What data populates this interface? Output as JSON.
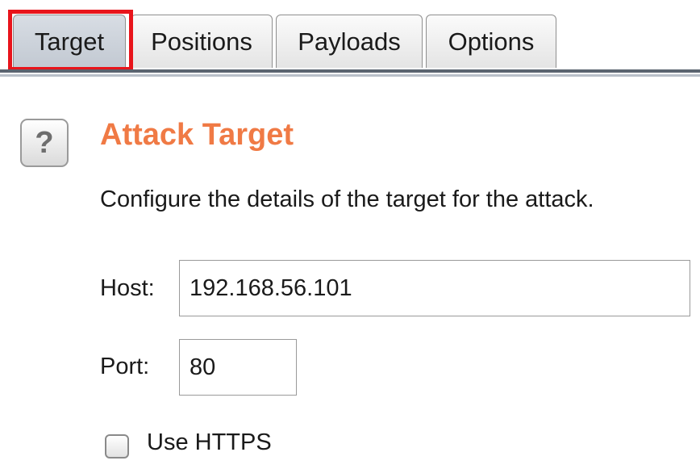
{
  "tabs": [
    {
      "label": "Target",
      "active": true
    },
    {
      "label": "Positions",
      "active": false
    },
    {
      "label": "Payloads",
      "active": false
    },
    {
      "label": "Options",
      "active": false
    }
  ],
  "highlight_color": "#e8141b",
  "help_button": {
    "label": "?"
  },
  "section": {
    "title": "Attack Target",
    "title_color": "#f07a45",
    "description": "Configure the details of the target for the attack."
  },
  "form": {
    "host_label": "Host:",
    "host_value": "192.168.56.101",
    "port_label": "Port:",
    "port_value": "80",
    "https_label": "Use HTTPS",
    "https_checked": false
  }
}
